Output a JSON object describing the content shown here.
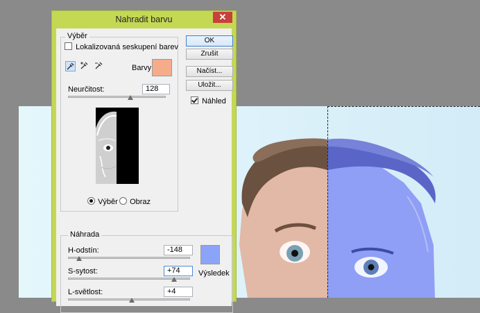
{
  "dialog": {
    "title": "Nahradit barvu",
    "close_label": "✕"
  },
  "selection": {
    "legend": "Výběr",
    "localized_label": "Lokalizovaná seskupení barev",
    "localized_checked": false,
    "colors_label": "Barvy:",
    "color_swatch": "#f5ac8a",
    "tools": [
      "eyedropper-icon",
      "eyedropper-plus-icon",
      "eyedropper-minus-icon"
    ],
    "fuzziness_label": "Neurčitost:",
    "fuzziness_value": "128",
    "fuzziness_level": 0.64,
    "view_selection_label": "Výběr",
    "view_image_label": "Obraz",
    "view_mode": "selection"
  },
  "buttons": {
    "ok": "OK",
    "cancel": "Zrušit",
    "load": "Načíst...",
    "save": "Uložit...",
    "preview_label": "Náhled",
    "preview_checked": true
  },
  "replacement": {
    "legend": "Náhrada",
    "hue_label": "H-odstín:",
    "hue_value": "-148",
    "hue_level": 0.089,
    "saturation_label": "S-sytost:",
    "saturation_value": "+74",
    "saturation_level": 0.87,
    "lightness_label": "L-světlost:",
    "lightness_value": "+4",
    "lightness_level": 0.52,
    "result_label": "Výsledek",
    "result_swatch": "#8ba4f9"
  },
  "colors": {
    "accent": "#c4d854",
    "close": "#c7413a",
    "canvas_bg": "#8a8a8a"
  }
}
